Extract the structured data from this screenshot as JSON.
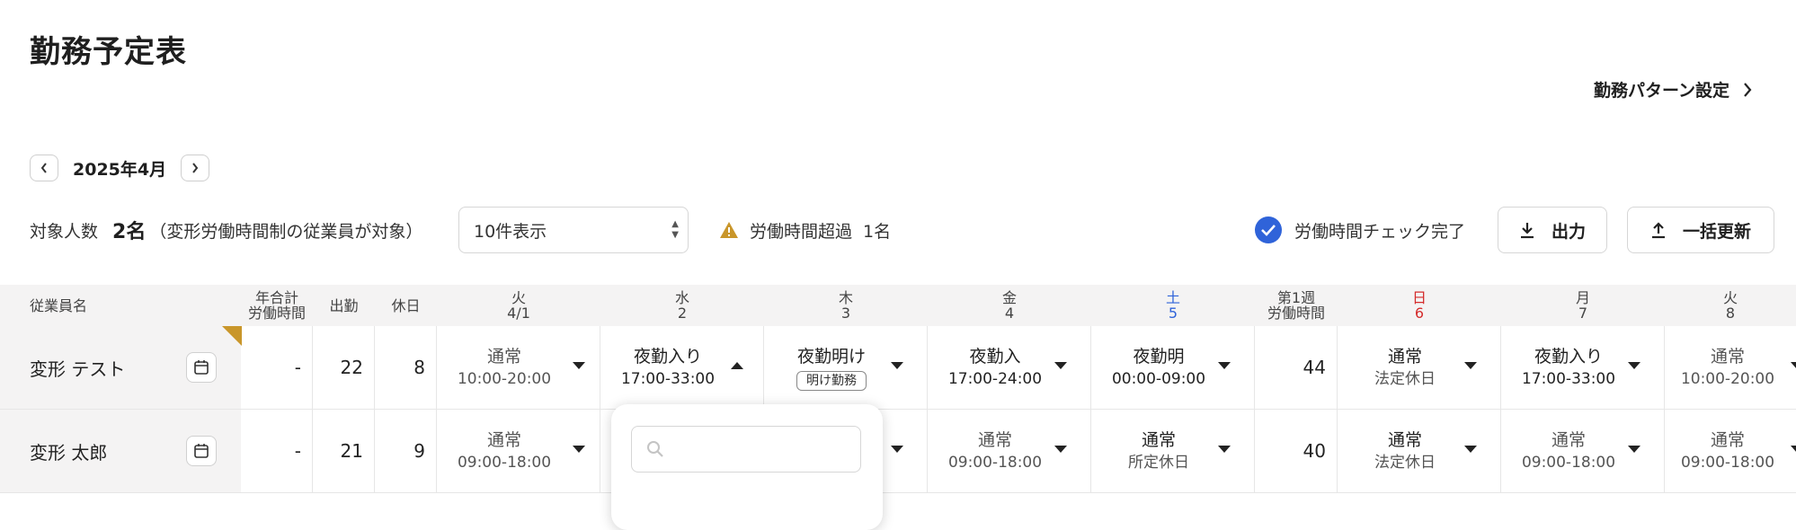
{
  "page": {
    "title": "勤務予定表",
    "pattern_link": "勤務パターン設定",
    "month": "2025年4月",
    "target_label": "対象人数",
    "target_count": "2名",
    "target_note": "（変形労働時間制の従業員が対象）",
    "page_size_select": "10件表示",
    "overtime_label": "労働時間超過",
    "overtime_count": "1名",
    "check_done_label": "労働時間チェック完了",
    "export_label": "出力",
    "bulk_update_label": "一括更新",
    "accent_color": "#2f63d9",
    "warning_color": "#c9962a",
    "holiday_color": "#d42b2b"
  },
  "table": {
    "header": {
      "employee": "従業員名",
      "annual_total_l1": "年合計",
      "annual_total_l2": "労働時間",
      "attendance": "出勤",
      "holiday": "休日",
      "days": [
        {
          "dow": "火",
          "date": "4/1",
          "type": "normal"
        },
        {
          "dow": "水",
          "date": "2",
          "type": "normal"
        },
        {
          "dow": "木",
          "date": "3",
          "type": "normal"
        },
        {
          "dow": "金",
          "date": "4",
          "type": "normal"
        },
        {
          "dow": "土",
          "date": "5",
          "type": "sat"
        }
      ],
      "week1_l1": "第1週",
      "week1_l2": "労働時間",
      "days2": [
        {
          "dow": "日",
          "date": "6",
          "type": "sun"
        },
        {
          "dow": "月",
          "date": "7",
          "type": "normal"
        },
        {
          "dow": "火",
          "date": "8",
          "type": "normal"
        }
      ]
    },
    "rows": [
      {
        "name": "変形 テスト",
        "annual": "-",
        "attendance": "22",
        "holiday": "8",
        "week1": "44",
        "shifts": [
          {
            "name": "通常",
            "time": "10:00-20:00"
          },
          {
            "name": "夜勤入り",
            "time": "17:00-33:00"
          },
          {
            "name": "夜勤明け",
            "tag": "明け勤務"
          },
          {
            "name": "夜勤入",
            "time": "17:00-24:00"
          },
          {
            "name": "夜勤明",
            "time": "00:00-09:00"
          },
          {
            "name": "通常",
            "time": "法定休日"
          },
          {
            "name": "夜勤入り",
            "time": "17:00-33:00"
          },
          {
            "name": "通常",
            "time": "10:00-20:00"
          }
        ]
      },
      {
        "name": "変形 太郎",
        "annual": "-",
        "attendance": "21",
        "holiday": "9",
        "week1": "40",
        "shifts": [
          {
            "name": "通常",
            "time": "09:00-18:00"
          },
          {
            "name": "",
            "time": ""
          },
          {
            "name": "",
            "time": ""
          },
          {
            "name": "通常",
            "time": "09:00-18:00"
          },
          {
            "name": "通常",
            "time": "所定休日"
          },
          {
            "name": "通常",
            "time": "法定休日"
          },
          {
            "name": "通常",
            "time": "09:00-18:00"
          },
          {
            "name": "通常",
            "time": "09:00-18:00"
          }
        ]
      }
    ]
  }
}
